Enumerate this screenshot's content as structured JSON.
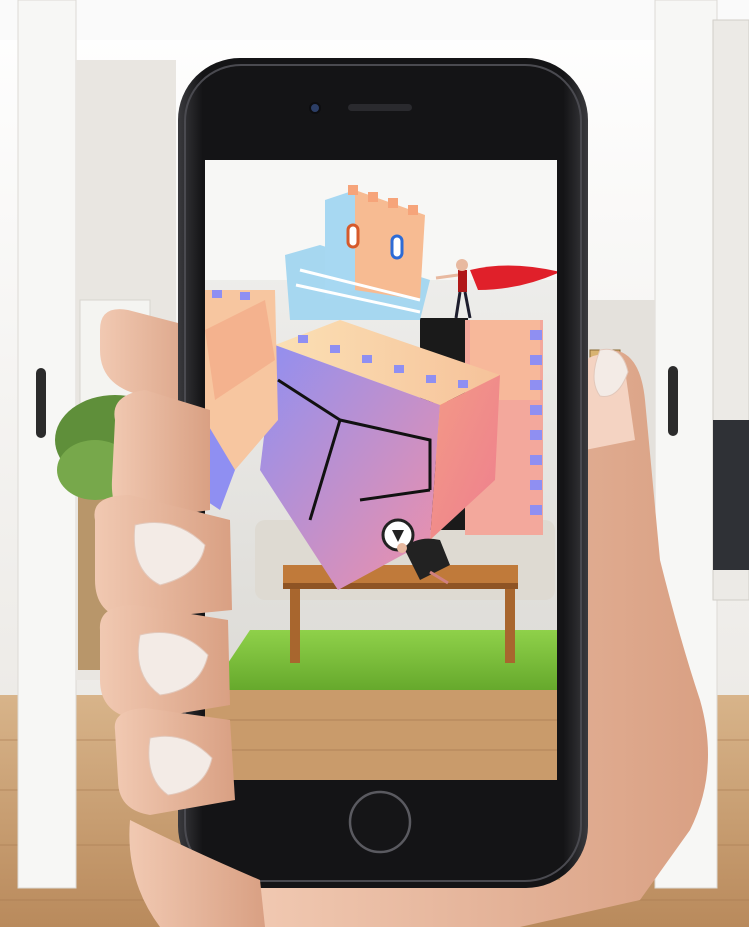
{
  "scene": {
    "kind": "photo-composite",
    "subject": "ar-game-on-smartphone",
    "colors": {
      "wall": "#ecebe8",
      "floor": "#c9a27a",
      "door_frame": "#f7f7f5",
      "phone_body": "#1b1b1d",
      "rug": "#7ec23a",
      "table": "#c07a3a",
      "tower_blue": "#9fd3ef",
      "tower_peach": "#f7b58a",
      "cube_pink": "#f08a8a",
      "cube_violet": "#a9a0f0",
      "cape_red": "#e0202a",
      "skin": "#e8b9a0",
      "nail": "#f2e6e0"
    },
    "icons": {
      "home_button": "home-button-icon",
      "front_camera": "camera-lens-icon",
      "speaker": "speaker-grille-icon",
      "door_handle": "door-handle-icon"
    }
  }
}
